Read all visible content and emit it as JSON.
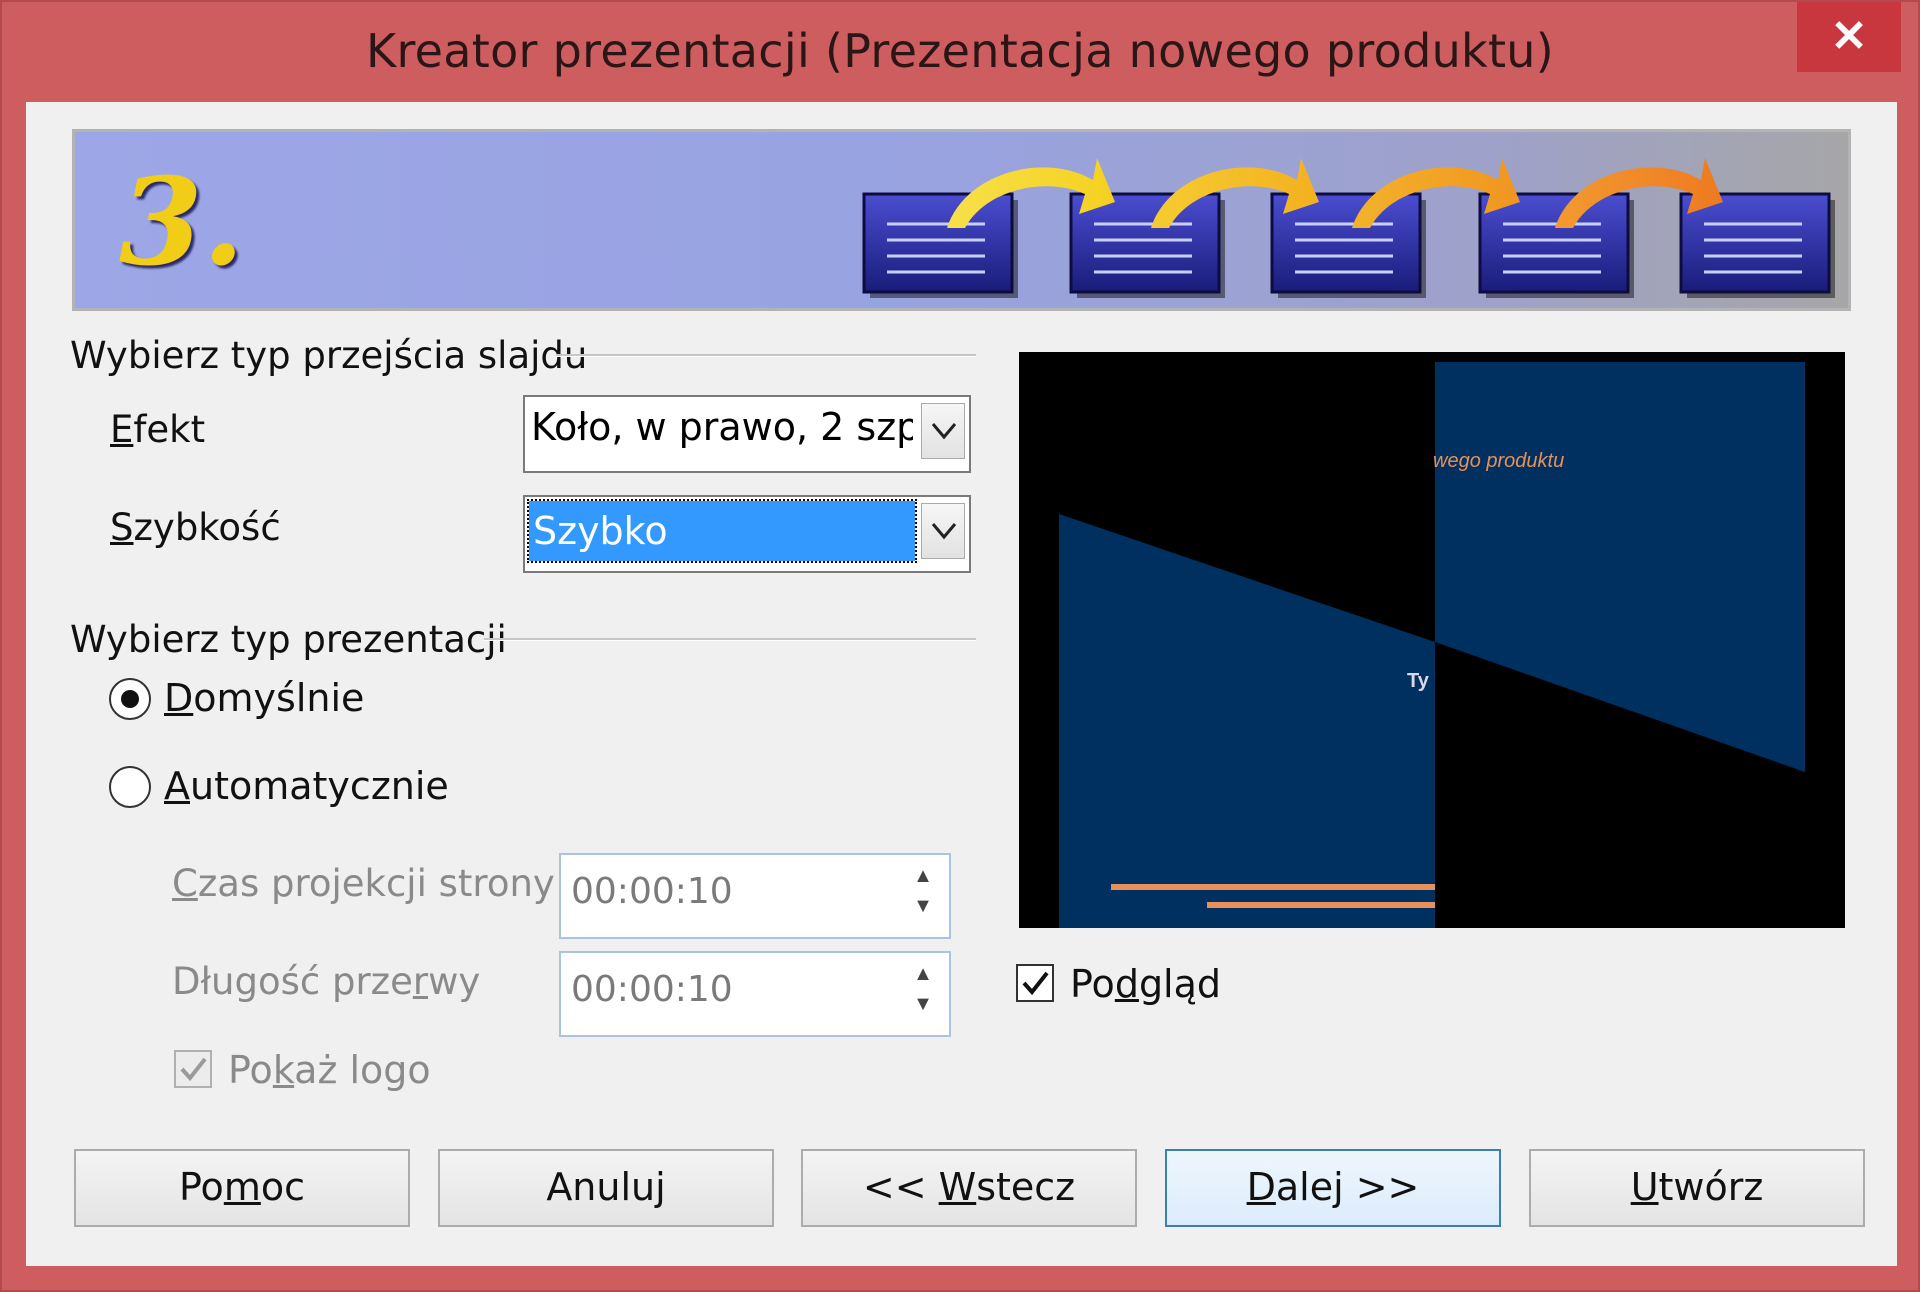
{
  "window": {
    "title": "Kreator prezentacji (Prezentacja nowego produktu)",
    "close_label": "✕",
    "accent_color": "#cd5d5f"
  },
  "banner": {
    "step_number": "3."
  },
  "transition_group": {
    "title": "Wybierz typ przejścia slajdu",
    "effect": {
      "label_prefix": "E",
      "label_rest": "fekt",
      "value": "Koło, w prawo, 2 szp"
    },
    "speed": {
      "label_prefix": "S",
      "label_rest": "zybkość",
      "value": "Szybko"
    }
  },
  "presentation_group": {
    "title": "Wybierz typ prezentacji",
    "default_option": {
      "prefix": "D",
      "rest": "omyślnie",
      "selected": true
    },
    "auto_option": {
      "prefix": "A",
      "rest": "utomatycznie",
      "selected": false
    },
    "page_time": {
      "label_prefix": "C",
      "label_rest": "zas projekcji strony",
      "value": "00:00:10"
    },
    "pause_length": {
      "label_before": "Długość prze",
      "label_u": "r",
      "label_after": "wy",
      "value": "00:00:10"
    },
    "show_logo": {
      "label_before": "Po",
      "label_u": "k",
      "label_after": "aż logo",
      "checked": true
    }
  },
  "preview": {
    "slide_title_fragment": "wego produktu",
    "slide_text_fragment": "Ty",
    "checkbox": {
      "label_before": "Po",
      "label_u": "d",
      "label_after": "gląd",
      "checked": true
    }
  },
  "buttons": {
    "help": {
      "before": "Po",
      "u": "m",
      "after": "oc"
    },
    "cancel": {
      "label": "Anuluj"
    },
    "back": {
      "before": "<< ",
      "u": "W",
      "after": "stecz"
    },
    "next": {
      "before": "",
      "u": "D",
      "after": "alej >>"
    },
    "create": {
      "before": "",
      "u": "U",
      "after": "twórz"
    }
  }
}
